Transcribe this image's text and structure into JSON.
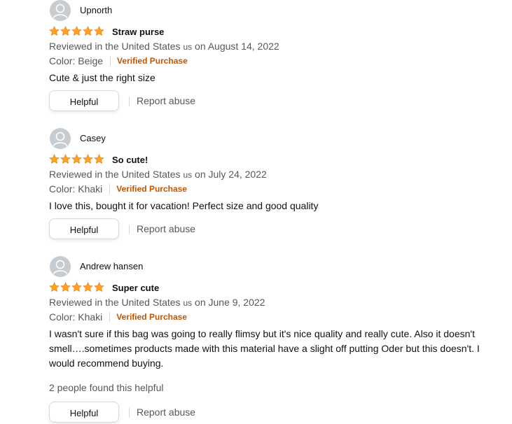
{
  "reviews": [
    {
      "reviewer": "Upnorth",
      "rating": 5,
      "title": "Straw purse",
      "date_prefix": "Reviewed in the United States",
      "date_us": "us",
      "date_suffix": "on August 14, 2022",
      "variant": "Color: Beige",
      "verified": "Verified Purchase",
      "body": "Cute & just the right size",
      "helpful_count": "",
      "helpful_label": "Helpful",
      "report_label": "Report abuse"
    },
    {
      "reviewer": "Casey",
      "rating": 5,
      "title": "So cute!",
      "date_prefix": "Reviewed in the United States",
      "date_us": "us",
      "date_suffix": "on July 24, 2022",
      "variant": "Color: Khaki",
      "verified": "Verified Purchase",
      "body": "I love this, bought it for vacation! Perfect size and good quality",
      "helpful_count": "",
      "helpful_label": "Helpful",
      "report_label": "Report abuse"
    },
    {
      "reviewer": "Andrew hansen",
      "rating": 5,
      "title": "Super cute",
      "date_prefix": "Reviewed in the United States",
      "date_us": "us",
      "date_suffix": "on June 9, 2022",
      "variant": "Color: Khaki",
      "verified": "Verified Purchase",
      "body": "I wasn't sure if this bag was going to really flimsy but it's nice quality and really cute. Also it doesn't smell….sometimes products made with this material have a slight off putting Oder but this doesn't. I would recommend buying.",
      "helpful_count": "2 people found this helpful",
      "helpful_label": "Helpful",
      "report_label": "Report abuse"
    }
  ],
  "colors": {
    "star_fill": "#ffa41c",
    "star_stroke": "#de7921",
    "verified": "#c45500",
    "muted_text": "#565959",
    "avatar_bg": "#c7ccd0"
  },
  "icons": {
    "avatar": "default-avatar-icon",
    "star": "star-icon"
  }
}
